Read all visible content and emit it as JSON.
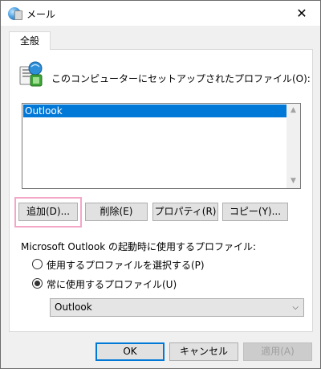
{
  "window": {
    "title": "メール",
    "close_glyph": "✕"
  },
  "tab": {
    "label": "全般"
  },
  "heading": "このコンピューターにセットアップされたプロファイル(O):",
  "profiles": {
    "items": [
      "Outlook"
    ],
    "selected_index": 0
  },
  "scroll_glyphs": {
    "up": "▲",
    "down": "▼"
  },
  "buttons": {
    "add": "追加(D)...",
    "delete": "削除(E)",
    "properties": "プロパティ(R)",
    "copy": "コピー(Y)..."
  },
  "startup": {
    "label": "Microsoft Outlook の起動時に使用するプロファイル:",
    "option_choose": "使用するプロファイルを選択する(P)",
    "option_always": "常に使用するプロファイル(U)",
    "selected_option": "always",
    "profile_value": "Outlook",
    "chevron": "⌵"
  },
  "footer": {
    "ok": "OK",
    "cancel": "キャンセル",
    "apply": "適用(A)"
  },
  "colors": {
    "accent": "#0078d7",
    "highlight_box": "#f2a7c7"
  }
}
